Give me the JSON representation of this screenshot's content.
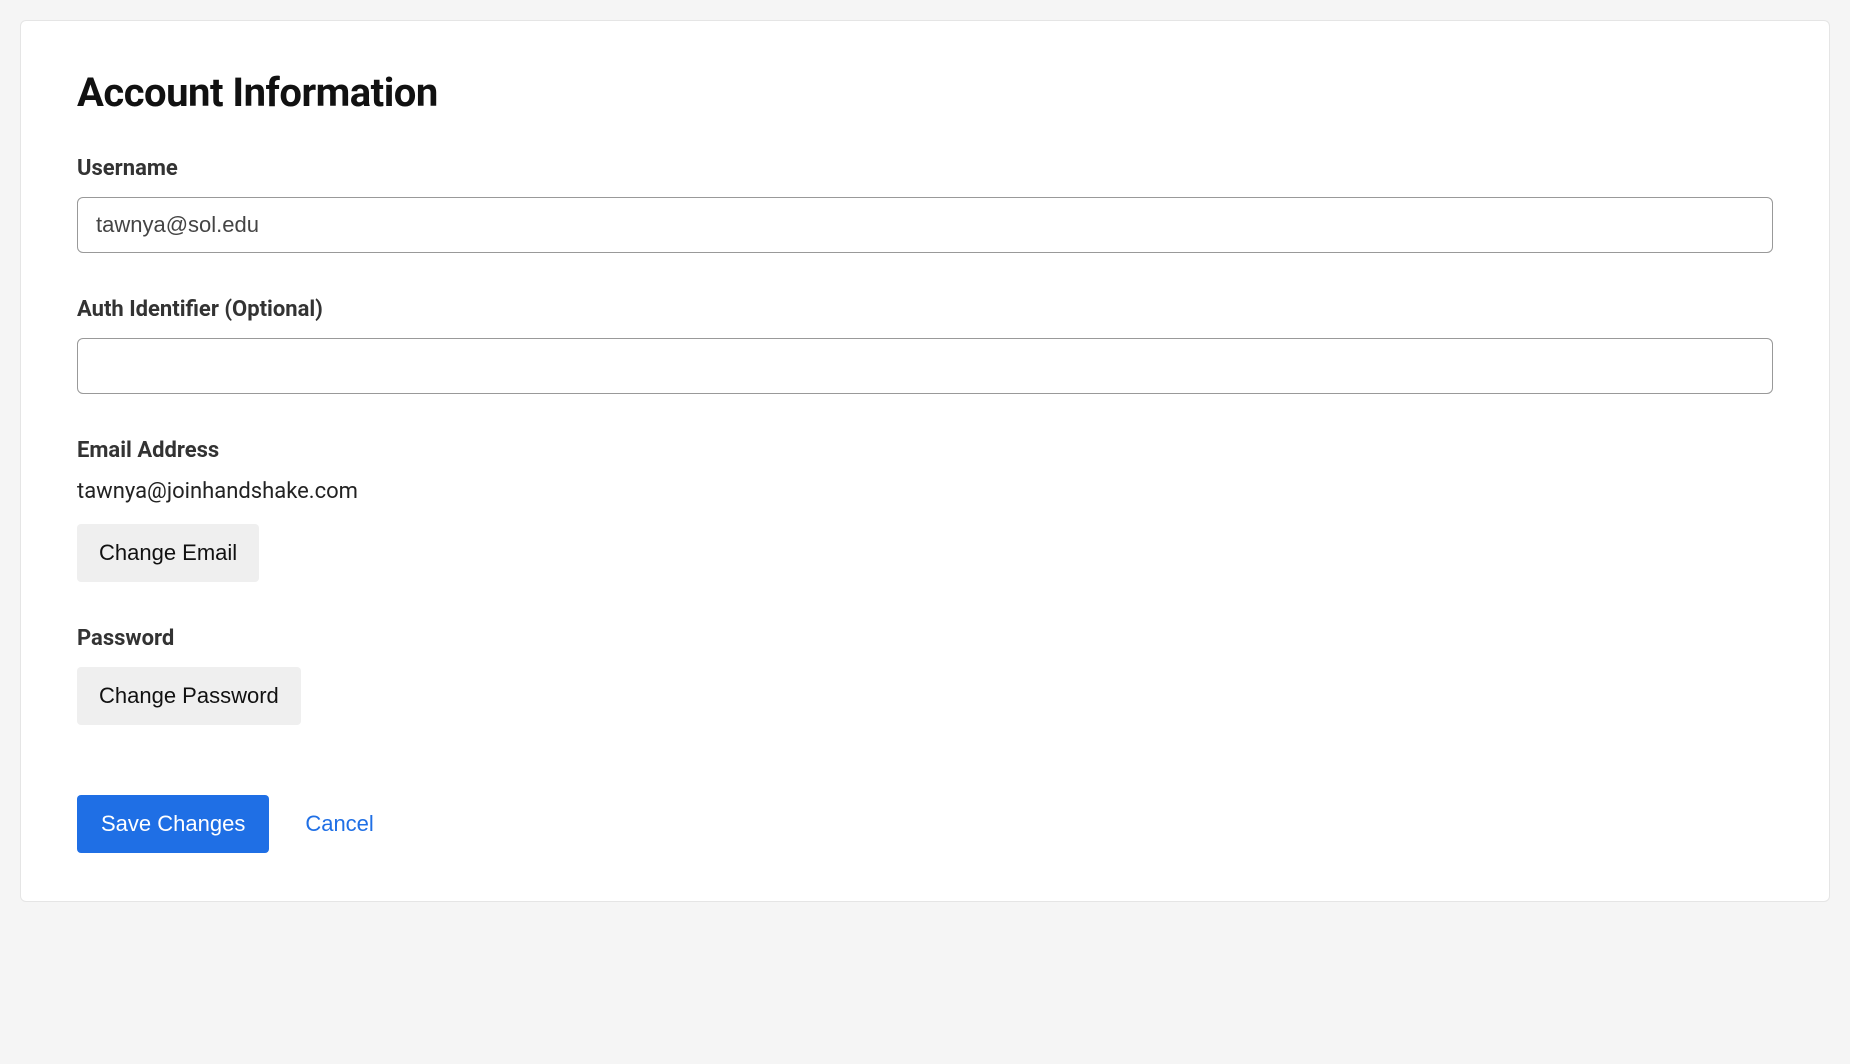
{
  "page": {
    "title": "Account Information"
  },
  "fields": {
    "username": {
      "label": "Username",
      "value": "tawnya@sol.edu"
    },
    "auth_identifier": {
      "label": "Auth Identifier (Optional)",
      "value": ""
    },
    "email": {
      "label": "Email Address",
      "value": "tawnya@joinhandshake.com",
      "change_button": "Change Email"
    },
    "password": {
      "label": "Password",
      "change_button": "Change Password"
    }
  },
  "actions": {
    "save": "Save Changes",
    "cancel": "Cancel"
  }
}
